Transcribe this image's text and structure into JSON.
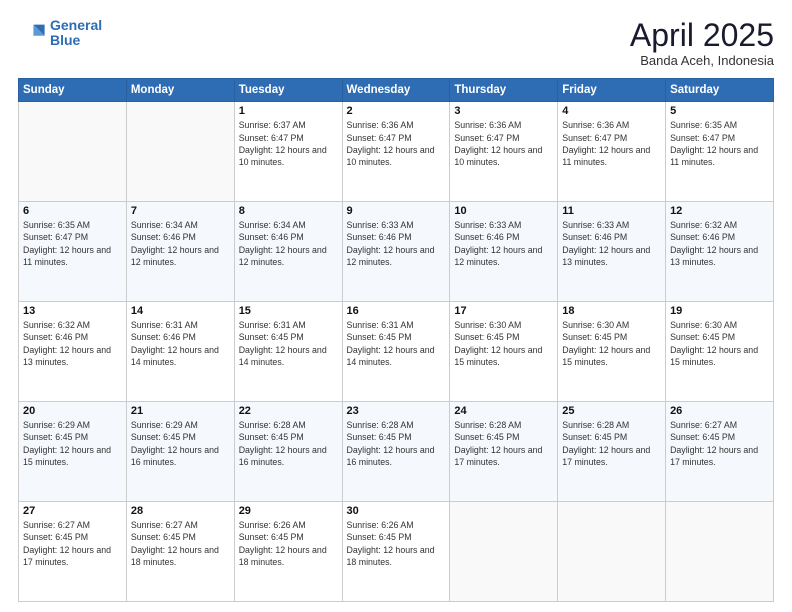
{
  "header": {
    "logo_line1": "General",
    "logo_line2": "Blue",
    "month_title": "April 2025",
    "subtitle": "Banda Aceh, Indonesia"
  },
  "days_of_week": [
    "Sunday",
    "Monday",
    "Tuesday",
    "Wednesday",
    "Thursday",
    "Friday",
    "Saturday"
  ],
  "weeks": [
    [
      {
        "day": "",
        "info": ""
      },
      {
        "day": "",
        "info": ""
      },
      {
        "day": "1",
        "info": "Sunrise: 6:37 AM\nSunset: 6:47 PM\nDaylight: 12 hours and 10 minutes."
      },
      {
        "day": "2",
        "info": "Sunrise: 6:36 AM\nSunset: 6:47 PM\nDaylight: 12 hours and 10 minutes."
      },
      {
        "day": "3",
        "info": "Sunrise: 6:36 AM\nSunset: 6:47 PM\nDaylight: 12 hours and 10 minutes."
      },
      {
        "day": "4",
        "info": "Sunrise: 6:36 AM\nSunset: 6:47 PM\nDaylight: 12 hours and 11 minutes."
      },
      {
        "day": "5",
        "info": "Sunrise: 6:35 AM\nSunset: 6:47 PM\nDaylight: 12 hours and 11 minutes."
      }
    ],
    [
      {
        "day": "6",
        "info": "Sunrise: 6:35 AM\nSunset: 6:47 PM\nDaylight: 12 hours and 11 minutes."
      },
      {
        "day": "7",
        "info": "Sunrise: 6:34 AM\nSunset: 6:46 PM\nDaylight: 12 hours and 12 minutes."
      },
      {
        "day": "8",
        "info": "Sunrise: 6:34 AM\nSunset: 6:46 PM\nDaylight: 12 hours and 12 minutes."
      },
      {
        "day": "9",
        "info": "Sunrise: 6:33 AM\nSunset: 6:46 PM\nDaylight: 12 hours and 12 minutes."
      },
      {
        "day": "10",
        "info": "Sunrise: 6:33 AM\nSunset: 6:46 PM\nDaylight: 12 hours and 12 minutes."
      },
      {
        "day": "11",
        "info": "Sunrise: 6:33 AM\nSunset: 6:46 PM\nDaylight: 12 hours and 13 minutes."
      },
      {
        "day": "12",
        "info": "Sunrise: 6:32 AM\nSunset: 6:46 PM\nDaylight: 12 hours and 13 minutes."
      }
    ],
    [
      {
        "day": "13",
        "info": "Sunrise: 6:32 AM\nSunset: 6:46 PM\nDaylight: 12 hours and 13 minutes."
      },
      {
        "day": "14",
        "info": "Sunrise: 6:31 AM\nSunset: 6:46 PM\nDaylight: 12 hours and 14 minutes."
      },
      {
        "day": "15",
        "info": "Sunrise: 6:31 AM\nSunset: 6:45 PM\nDaylight: 12 hours and 14 minutes."
      },
      {
        "day": "16",
        "info": "Sunrise: 6:31 AM\nSunset: 6:45 PM\nDaylight: 12 hours and 14 minutes."
      },
      {
        "day": "17",
        "info": "Sunrise: 6:30 AM\nSunset: 6:45 PM\nDaylight: 12 hours and 15 minutes."
      },
      {
        "day": "18",
        "info": "Sunrise: 6:30 AM\nSunset: 6:45 PM\nDaylight: 12 hours and 15 minutes."
      },
      {
        "day": "19",
        "info": "Sunrise: 6:30 AM\nSunset: 6:45 PM\nDaylight: 12 hours and 15 minutes."
      }
    ],
    [
      {
        "day": "20",
        "info": "Sunrise: 6:29 AM\nSunset: 6:45 PM\nDaylight: 12 hours and 15 minutes."
      },
      {
        "day": "21",
        "info": "Sunrise: 6:29 AM\nSunset: 6:45 PM\nDaylight: 12 hours and 16 minutes."
      },
      {
        "day": "22",
        "info": "Sunrise: 6:28 AM\nSunset: 6:45 PM\nDaylight: 12 hours and 16 minutes."
      },
      {
        "day": "23",
        "info": "Sunrise: 6:28 AM\nSunset: 6:45 PM\nDaylight: 12 hours and 16 minutes."
      },
      {
        "day": "24",
        "info": "Sunrise: 6:28 AM\nSunset: 6:45 PM\nDaylight: 12 hours and 17 minutes."
      },
      {
        "day": "25",
        "info": "Sunrise: 6:28 AM\nSunset: 6:45 PM\nDaylight: 12 hours and 17 minutes."
      },
      {
        "day": "26",
        "info": "Sunrise: 6:27 AM\nSunset: 6:45 PM\nDaylight: 12 hours and 17 minutes."
      }
    ],
    [
      {
        "day": "27",
        "info": "Sunrise: 6:27 AM\nSunset: 6:45 PM\nDaylight: 12 hours and 17 minutes."
      },
      {
        "day": "28",
        "info": "Sunrise: 6:27 AM\nSunset: 6:45 PM\nDaylight: 12 hours and 18 minutes."
      },
      {
        "day": "29",
        "info": "Sunrise: 6:26 AM\nSunset: 6:45 PM\nDaylight: 12 hours and 18 minutes."
      },
      {
        "day": "30",
        "info": "Sunrise: 6:26 AM\nSunset: 6:45 PM\nDaylight: 12 hours and 18 minutes."
      },
      {
        "day": "",
        "info": ""
      },
      {
        "day": "",
        "info": ""
      },
      {
        "day": "",
        "info": ""
      }
    ]
  ]
}
